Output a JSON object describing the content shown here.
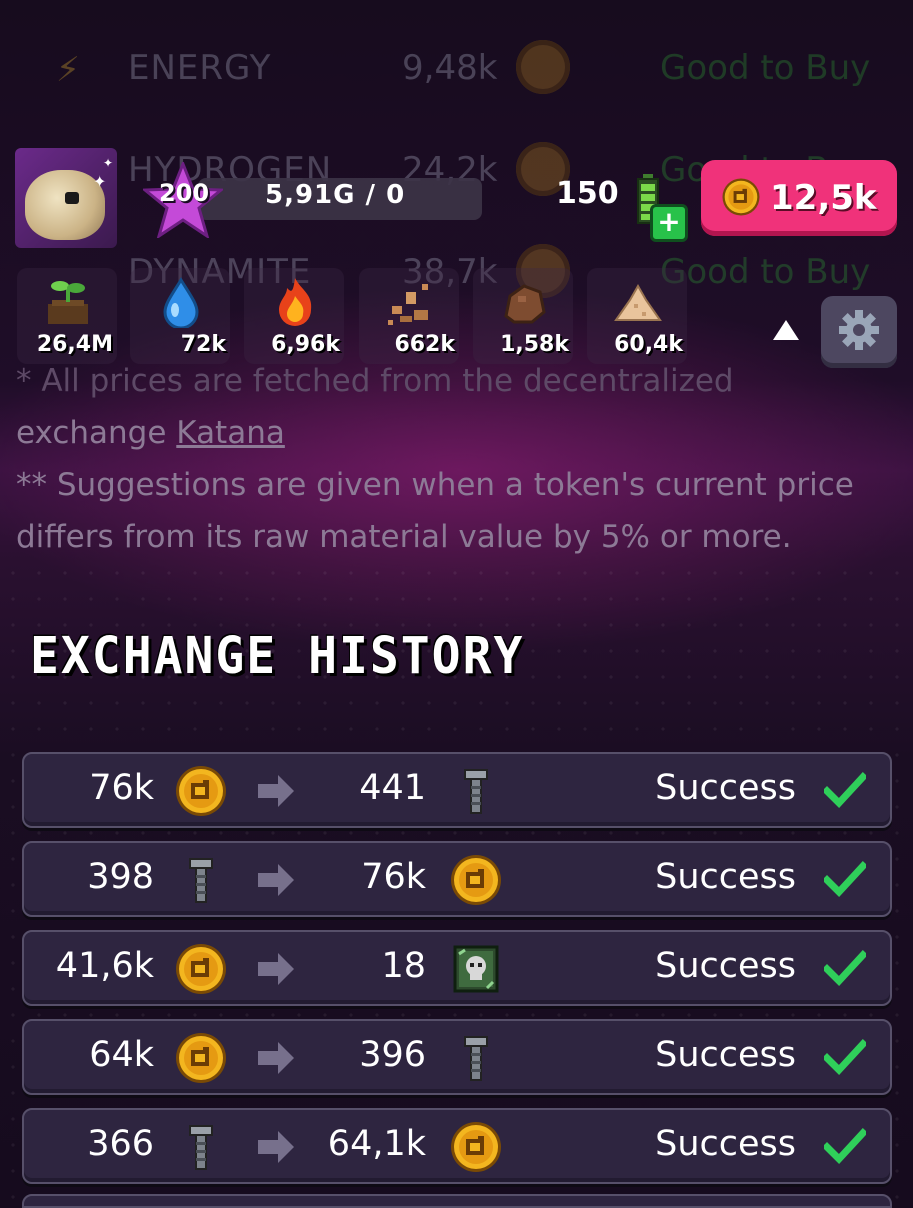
{
  "background_market": {
    "rows": [
      {
        "name": "ENERGY",
        "price": "9,48k",
        "suggestion": "Good to Buy"
      },
      {
        "name": "HYDROGEN",
        "price": "24,2k",
        "suggestion": "Good to Buy"
      },
      {
        "name": "DYNAMITE",
        "price": "38,7k",
        "suggestion": "Good to Buy"
      }
    ],
    "note1": "* All prices are fetched from the decentralized",
    "note1b_prefix": "exchange ",
    "note1b_link": "Katana",
    "note2a": "** Suggestions are given when a token's current price",
    "note2b": "differs from its raw material value by 5% or more."
  },
  "hud": {
    "level": "200",
    "xp": "5,91G / 0",
    "energy": "150",
    "gold": "12,5k",
    "resources": [
      {
        "icon": "plant-icon",
        "value": "26,4M"
      },
      {
        "icon": "water-drop-icon",
        "value": "72k"
      },
      {
        "icon": "fire-icon",
        "value": "6,96k"
      },
      {
        "icon": "ore-icon",
        "value": "662k"
      },
      {
        "icon": "rock-icon",
        "value": "1,58k"
      },
      {
        "icon": "sand-icon",
        "value": "60,4k"
      }
    ]
  },
  "history": {
    "title": "EXCHANGE HISTORY",
    "rows": [
      {
        "from_amount": "76k",
        "from_icon": "gold-coin-icon",
        "to_amount": "441",
        "to_icon": "screw-icon",
        "status": "Success"
      },
      {
        "from_amount": "398",
        "from_icon": "screw-icon",
        "to_amount": "76k",
        "to_icon": "gold-coin-icon",
        "status": "Success"
      },
      {
        "from_amount": "41,6k",
        "from_icon": "gold-coin-icon",
        "to_amount": "18",
        "to_icon": "skull-card-icon",
        "status": "Success"
      },
      {
        "from_amount": "64k",
        "from_icon": "gold-coin-icon",
        "to_amount": "396",
        "to_icon": "screw-icon",
        "status": "Success"
      },
      {
        "from_amount": "366",
        "from_icon": "screw-icon",
        "to_amount": "64,1k",
        "to_icon": "gold-coin-icon",
        "status": "Success"
      }
    ]
  },
  "colors": {
    "accent_pink": "#f0327a",
    "success_green": "#2fcf5a",
    "coin_gold": "#f3b61f"
  }
}
